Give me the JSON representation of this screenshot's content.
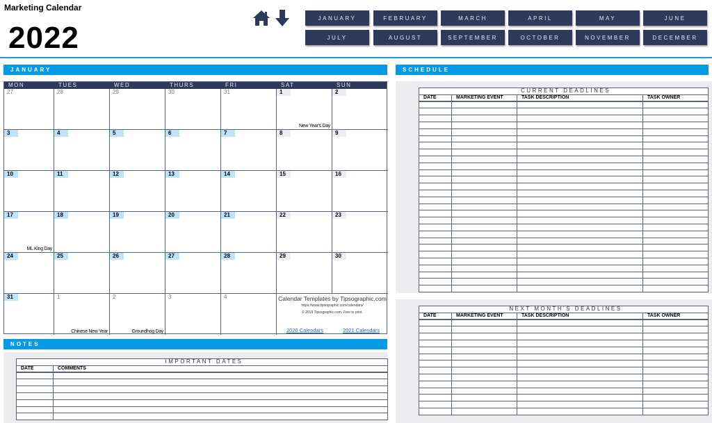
{
  "app": {
    "title": "Marketing Calendar",
    "year": "2022"
  },
  "nav_icons": [
    "home-icon",
    "arrow-down-icon"
  ],
  "months": [
    "JANUARY",
    "FEBRUARY",
    "MARCH",
    "APRIL",
    "MAY",
    "JUNE",
    "JULY",
    "AUGUST",
    "SEPTEMBER",
    "OCTOBER",
    "NOVEMBER",
    "DECEMBER"
  ],
  "calendar": {
    "section_title": "JANUARY",
    "weekdays": [
      "MON",
      "TUES",
      "WED",
      "THURS",
      "FRI",
      "SAT",
      "SUN"
    ],
    "weeks": [
      [
        {
          "d": "27",
          "t": "other"
        },
        {
          "d": "28",
          "t": "other"
        },
        {
          "d": "29",
          "t": "other"
        },
        {
          "d": "30",
          "t": "other"
        },
        {
          "d": "31",
          "t": "other"
        },
        {
          "d": "1",
          "t": "wk",
          "h": "New Year's Day"
        },
        {
          "d": "2",
          "t": "wk"
        }
      ],
      [
        {
          "d": "3",
          "t": "cur"
        },
        {
          "d": "4",
          "t": "cur"
        },
        {
          "d": "5",
          "t": "cur"
        },
        {
          "d": "6",
          "t": "cur"
        },
        {
          "d": "7",
          "t": "cur"
        },
        {
          "d": "8",
          "t": "wk"
        },
        {
          "d": "9",
          "t": "wk"
        }
      ],
      [
        {
          "d": "10",
          "t": "cur"
        },
        {
          "d": "11",
          "t": "cur"
        },
        {
          "d": "12",
          "t": "cur"
        },
        {
          "d": "13",
          "t": "cur"
        },
        {
          "d": "14",
          "t": "cur"
        },
        {
          "d": "15",
          "t": "wk"
        },
        {
          "d": "16",
          "t": "wk"
        }
      ],
      [
        {
          "d": "17",
          "t": "cur",
          "h": "ML King Day"
        },
        {
          "d": "18",
          "t": "cur"
        },
        {
          "d": "19",
          "t": "cur"
        },
        {
          "d": "20",
          "t": "cur"
        },
        {
          "d": "21",
          "t": "cur"
        },
        {
          "d": "22",
          "t": "wk"
        },
        {
          "d": "23",
          "t": "wk"
        }
      ],
      [
        {
          "d": "24",
          "t": "cur"
        },
        {
          "d": "25",
          "t": "cur"
        },
        {
          "d": "26",
          "t": "cur"
        },
        {
          "d": "27",
          "t": "cur"
        },
        {
          "d": "28",
          "t": "cur"
        },
        {
          "d": "29",
          "t": "wk"
        },
        {
          "d": "30",
          "t": "wk"
        }
      ],
      [
        {
          "d": "31",
          "t": "cur"
        },
        {
          "d": "1",
          "t": "other",
          "h": "Chinese New Year"
        },
        {
          "d": "2",
          "t": "other",
          "h": "Groundhog Day"
        },
        {
          "d": "3",
          "t": "other"
        },
        {
          "d": "4",
          "t": "other"
        }
      ]
    ],
    "promo": {
      "title": "Calendar Templates by Tipsographic.com",
      "url": "https://www.tipsographic.com/calendars/",
      "copyright": "© 2019 Tipsographic.com. Free to print.",
      "link1": "2020 Calendars",
      "link2": "2021 Calendars"
    }
  },
  "notes": {
    "section_title": "NOTES",
    "table_title": "IMPORTANT DATES",
    "columns": [
      "DATE",
      "COMMENTS"
    ],
    "row_count": 7
  },
  "schedule": {
    "section_title": "SCHEDULE",
    "current": {
      "title": "CURRENT DEADLINES",
      "columns": [
        "DATE",
        "MARKETING EVENT",
        "TASK DESCRIPTION",
        "TASK OWNER"
      ],
      "row_count": 28
    },
    "next": {
      "title": "NEXT MONTH'S DEADLINES",
      "columns": [
        "DATE",
        "MARKETING EVENT",
        "TASK DESCRIPTION",
        "TASK OWNER"
      ],
      "row_count": 14
    }
  }
}
